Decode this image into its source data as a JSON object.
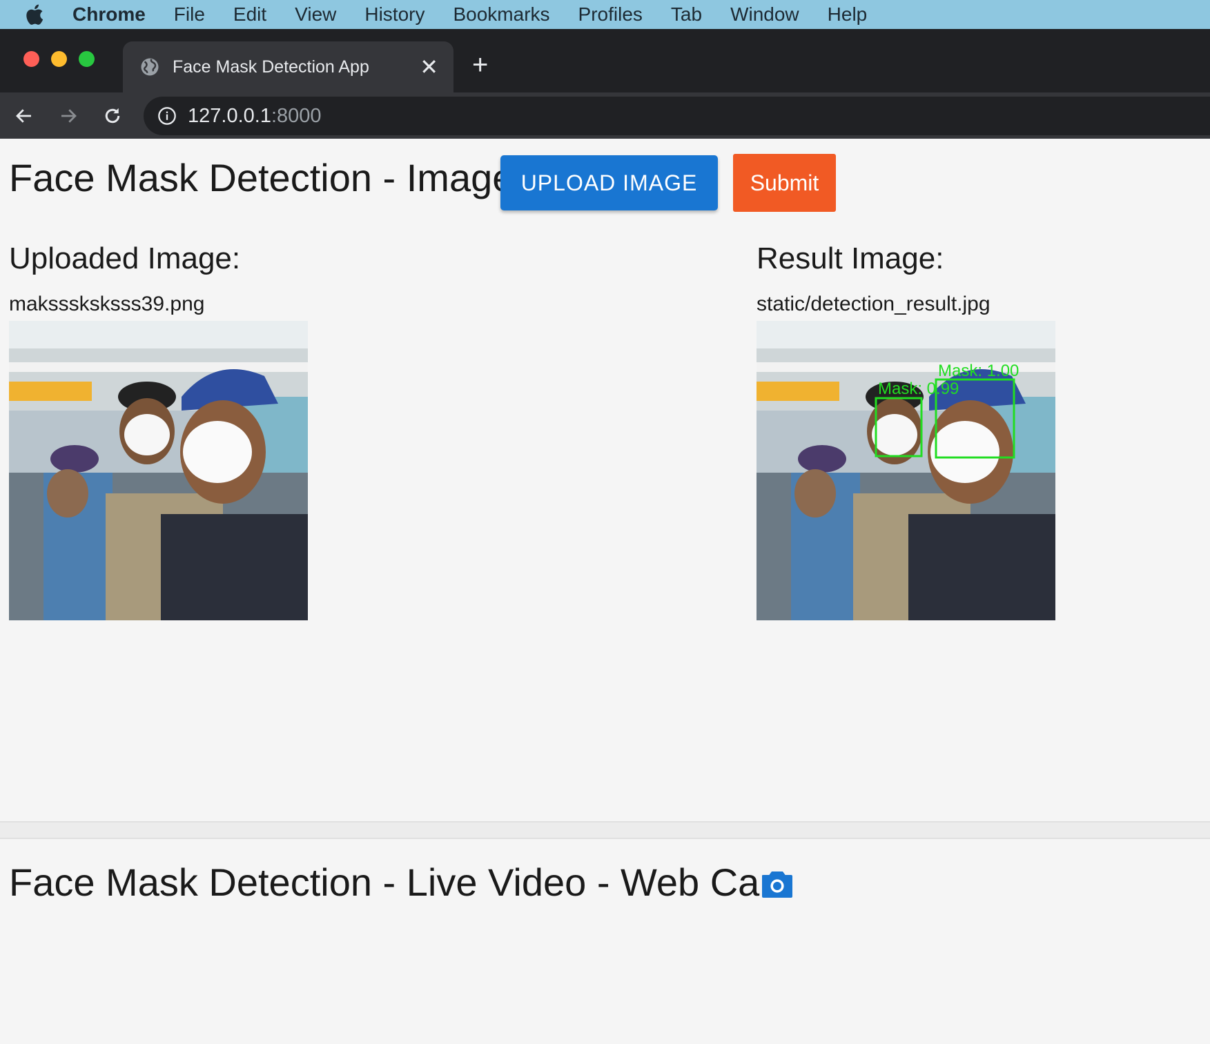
{
  "menubar": {
    "app_name": "Chrome",
    "items": [
      "File",
      "Edit",
      "View",
      "History",
      "Bookmarks",
      "Profiles",
      "Tab",
      "Window",
      "Help"
    ]
  },
  "browser": {
    "tab_title": "Face Mask Detection App",
    "close_glyph": "✕",
    "new_tab_glyph": "+",
    "url_host": "127.0.0.1",
    "url_port": ":8000"
  },
  "page": {
    "image_section_title": "Face Mask Detection - Image",
    "upload_button": "UPLOAD IMAGE",
    "submit_button": "Submit",
    "uploaded_label": "Uploaded Image:",
    "uploaded_filename": "maksssksksss39.png",
    "result_label": "Result Image:",
    "result_filename": "static/detection_result.jpg",
    "detections": [
      {
        "label": "Mask: 0.99"
      },
      {
        "label": "Mask: 1.00"
      }
    ],
    "video_section_title": "Face Mask Detection - Live Video - Web Cam"
  },
  "colors": {
    "menubar_bg": "#8ec7e0",
    "upload_button_bg": "#1976d2",
    "submit_button_bg": "#f15a24",
    "detection_box": "#22dd22",
    "camera_icon": "#1976d2"
  }
}
